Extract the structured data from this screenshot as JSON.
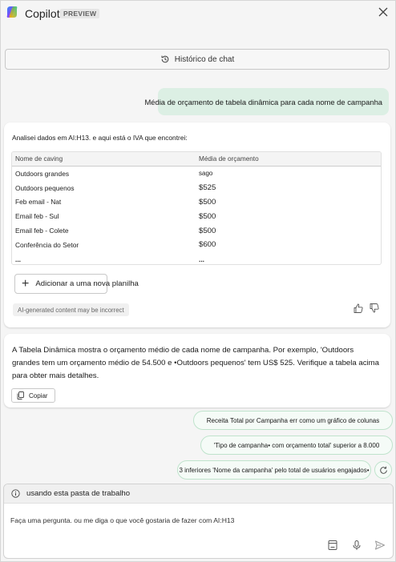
{
  "app": {
    "title": "Copilot",
    "badge": "PREVIEW"
  },
  "history_button": {
    "label": "Histórico de chat"
  },
  "user_message": "Média de orçamento de tabela dinâmica para cada nome de campanha",
  "result_card": {
    "intro": "Analisei dados em  AI:H13. e aqui está o IVA que encontrei:",
    "columns": [
      "Nome de caving",
      "Média de orçamento"
    ],
    "rows": [
      [
        "Outdoors grandes",
        "sago"
      ],
      [
        "Outdoors pequenos",
        "$525"
      ],
      [
        "Feb email - Nat",
        "$500"
      ],
      [
        "Email feb - Sul",
        "$500"
      ],
      [
        "Email feb - Colete",
        "$500"
      ],
      [
        "Conferência do Setor",
        "$600"
      ],
      [
        "...",
        "..."
      ]
    ],
    "add_button": "Adicionar a uma nova planilha",
    "ai_notice": "AI-generated content may be incorrect"
  },
  "answer_card": {
    "text": "A Tabela Dinâmica mostra o orçamento médio de cada nome de campanha. Por exemplo, 'Outdoors grandes tem um orçamento médio de 54.500 e •Outdoors pequenos' tem US$ 525. Verifique a tabela acima para obter mais detalhes.",
    "copy_label": "Copiar"
  },
  "suggestions": [
    "Receita Total por Campanha err como um gráfico de colunas",
    "'Tipo de campanha• com orçamento total' superior a 8.000",
    "3 inferiores 'Nome da campanha' pelo total de usuários engajados•"
  ],
  "composer": {
    "context": "usando esta pasta de trabalho",
    "placeholder": "Faça uma pergunta. ou me diga o que você gostaria de fazer com AI:H13"
  },
  "colors": {
    "accent_green": "#dcefe4",
    "suggestion_border": "#bfe3cc"
  }
}
